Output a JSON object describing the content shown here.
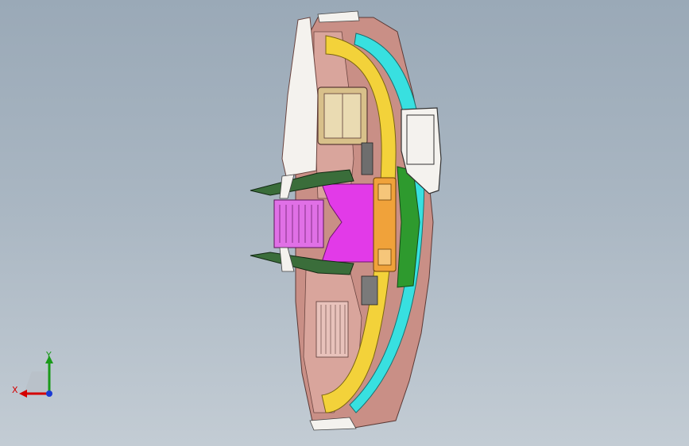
{
  "viewport": {
    "background_top": "#9aa9b7",
    "background_bottom": "#c3ccd4"
  },
  "model": {
    "description_colors": {
      "shell": "#c98f86",
      "shell_dark": "#8d5a55",
      "shell_light": "#e8c2bb",
      "duct_yellow": "#f3d23a",
      "duct_cyan": "#38e0e0",
      "duct_magenta": "#e23ae8",
      "bracket_green": "#2e9a2e",
      "white_part": "#f4f2ee",
      "orange_part": "#f0a23a",
      "tan_box": "#d8c08a"
    }
  },
  "triad": {
    "x_label": "X",
    "y_label": "Y",
    "x_color": "#d40000",
    "y_color": "#1a9a1a",
    "z_color": "#1a3ad4"
  }
}
